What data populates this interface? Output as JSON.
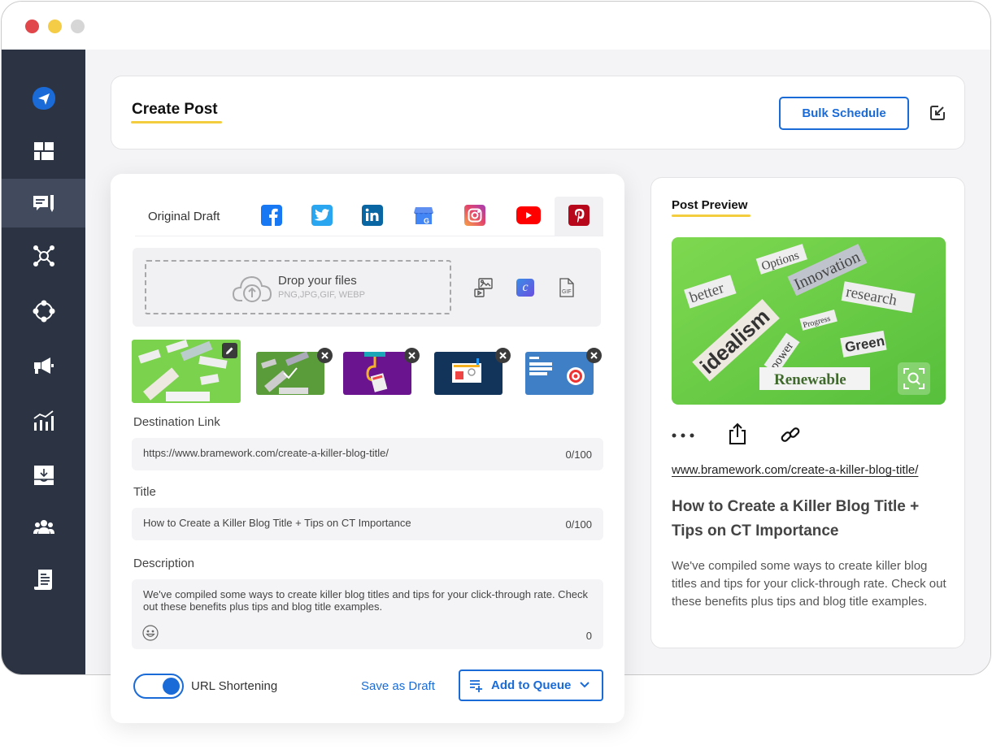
{
  "window": {
    "controls": [
      "close",
      "minimize",
      "maximize"
    ]
  },
  "sidebar": {
    "items": [
      {
        "id": "logo",
        "icon": "paper-plane-icon",
        "active": false
      },
      {
        "id": "dashboard",
        "icon": "dashboard-grid-icon",
        "active": false
      },
      {
        "id": "posts",
        "icon": "compose-post-icon",
        "active": true
      },
      {
        "id": "network",
        "icon": "network-hub-icon",
        "active": false
      },
      {
        "id": "connections",
        "icon": "circle-nodes-icon",
        "active": false
      },
      {
        "id": "campaigns",
        "icon": "megaphone-icon",
        "active": false
      },
      {
        "id": "analytics",
        "icon": "analytics-chart-icon",
        "active": false
      },
      {
        "id": "inbox",
        "icon": "inbox-download-icon",
        "active": false
      },
      {
        "id": "team",
        "icon": "team-users-icon",
        "active": false
      },
      {
        "id": "reports",
        "icon": "document-scroll-icon",
        "active": false
      }
    ]
  },
  "header": {
    "title": "Create Post",
    "bulk_schedule_label": "Bulk Schedule",
    "export_icon": "export-arrow-icon"
  },
  "editor": {
    "tabs": [
      {
        "label": "Original Draft",
        "type": "text"
      },
      {
        "label": "Facebook",
        "icon": "facebook-icon",
        "color": "#1877f2"
      },
      {
        "label": "Twitter",
        "icon": "twitter-icon",
        "color": "#1da1f2"
      },
      {
        "label": "LinkedIn",
        "icon": "linkedin-icon",
        "color": "#0a66c2"
      },
      {
        "label": "Google Business",
        "icon": "google-business-icon",
        "color": "#4285f4"
      },
      {
        "label": "Instagram",
        "icon": "instagram-icon",
        "color": "#e1306c"
      },
      {
        "label": "YouTube",
        "icon": "youtube-icon",
        "color": "#ff0000"
      },
      {
        "label": "Pinterest",
        "icon": "pinterest-icon",
        "color": "#bd081c",
        "active": true
      }
    ],
    "upload": {
      "title": "Drop your files",
      "subtitle": "PNG,JPG,GIF, WEBP",
      "tools": [
        "media-library-icon",
        "canva-icon",
        "gif-icon"
      ]
    },
    "thumbnails": [
      {
        "label": "idealism words",
        "selected": true,
        "action": "edit"
      },
      {
        "label": "idealism words checked",
        "selected": false,
        "action": "remove"
      },
      {
        "label": "purple hook graphic",
        "selected": false,
        "action": "remove"
      },
      {
        "label": "blue dashboard graphic",
        "selected": false,
        "action": "remove"
      },
      {
        "label": "killer marketing strategy graphic",
        "selected": false,
        "action": "remove"
      }
    ],
    "destination_link": {
      "label": "Destination Link",
      "value": "https://www.bramework.com/create-a-killer-blog-title/",
      "count": "0/100"
    },
    "title_field": {
      "label": "Title",
      "value": "How to Create a Killer Blog Title + Tips on CT Importance",
      "count": "0/100"
    },
    "description": {
      "label": "Description",
      "value": "We've compiled some ways to create killer blog titles and tips for your click-through rate. Check out these benefits plus tips and blog title examples.",
      "count": "0"
    },
    "url_shortening": {
      "label": "URL Shortening",
      "enabled": true
    },
    "save_draft_label": "Save as Draft",
    "add_queue_label": "Add to Queue"
  },
  "preview": {
    "title": "Post Preview",
    "link": "www.bramework.com/create-a-killer-blog-title/",
    "headline": "How to Create a Killer Blog Title + Tips on CT Importance",
    "description": "We've compiled some ways to create killer blog titles and tips for your click-through rate. Check out these benefits plus tips and blog title examples.",
    "image_words": [
      "better",
      "Options",
      "Innovation",
      "research",
      "idealism",
      "Progress",
      "power",
      "Green",
      "Renewable"
    ]
  },
  "colors": {
    "accent": "#1a6bd8",
    "sidebar_bg": "#2c3444",
    "sidebar_active": "#414b5d",
    "underline": "#f4cd3f"
  }
}
